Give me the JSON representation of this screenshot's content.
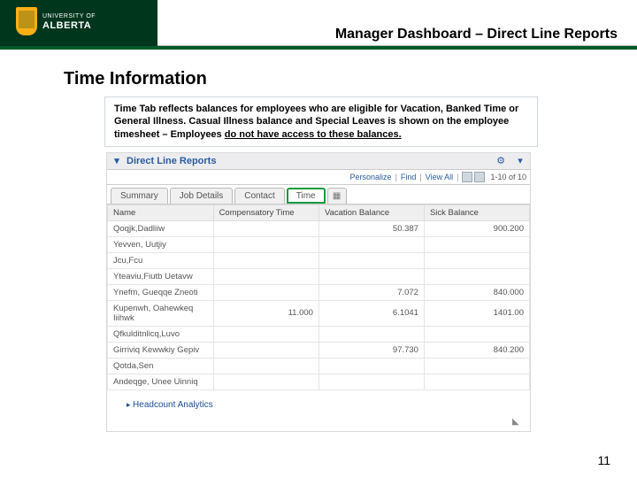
{
  "header": {
    "org_top": "UNIVERSITY OF",
    "org_bottom": "ALBERTA",
    "title": "Manager Dashboard – Direct Line Reports"
  },
  "section": {
    "heading": "Time Information",
    "callout_a": "Time Tab reflects balances for employees who are eligible for Vacation, Banked Time or General Illness. Casual Illness balance and Special Leaves is shown on the employee timesheet – Employees ",
    "callout_b": "do not have access to these balances."
  },
  "panel": {
    "title": "Direct Line Reports",
    "toolbar": {
      "personalize": "Personalize",
      "find": "Find",
      "viewall": "View All",
      "count": "1-10 of 10"
    },
    "tabs": [
      "Summary",
      "Job Details",
      "Contact",
      "Time"
    ],
    "active_tab": 3,
    "columns": [
      "Name",
      "Compensatory Time",
      "Vacation Balance",
      "Sick Balance"
    ],
    "rows": [
      {
        "name": "Qoqjk,Dadliiw",
        "comp": "",
        "vac": "50.387",
        "sick": "900.200"
      },
      {
        "name": "Yevven, Uutjiy",
        "comp": "",
        "vac": "",
        "sick": ""
      },
      {
        "name": "Jcu,Fcu",
        "comp": "",
        "vac": "",
        "sick": ""
      },
      {
        "name": "Yteaviu,Fiutb Uetavw",
        "comp": "",
        "vac": "",
        "sick": ""
      },
      {
        "name": "Ynefm, Gueqqe Zneoti",
        "comp": "",
        "vac": "7.072",
        "sick": "840.000"
      },
      {
        "name": "Kupenwh, Oahewkeq Iiihwk",
        "comp": "11.000",
        "vac": "6.1041",
        "sick": "1401.00"
      },
      {
        "name": "Qfkulditnlicq,Luvo",
        "comp": "",
        "vac": "",
        "sick": ""
      },
      {
        "name": "Girriviq Kewwkiy Gepiv",
        "comp": "",
        "vac": "97.730",
        "sick": "840.200"
      },
      {
        "name": "Qotda,Sen",
        "comp": "",
        "vac": "",
        "sick": ""
      },
      {
        "name": "Andeqge, Unee Uinniq",
        "comp": "",
        "vac": "",
        "sick": ""
      }
    ],
    "footer_link": "Headcount Analytics"
  },
  "page_number": "11"
}
